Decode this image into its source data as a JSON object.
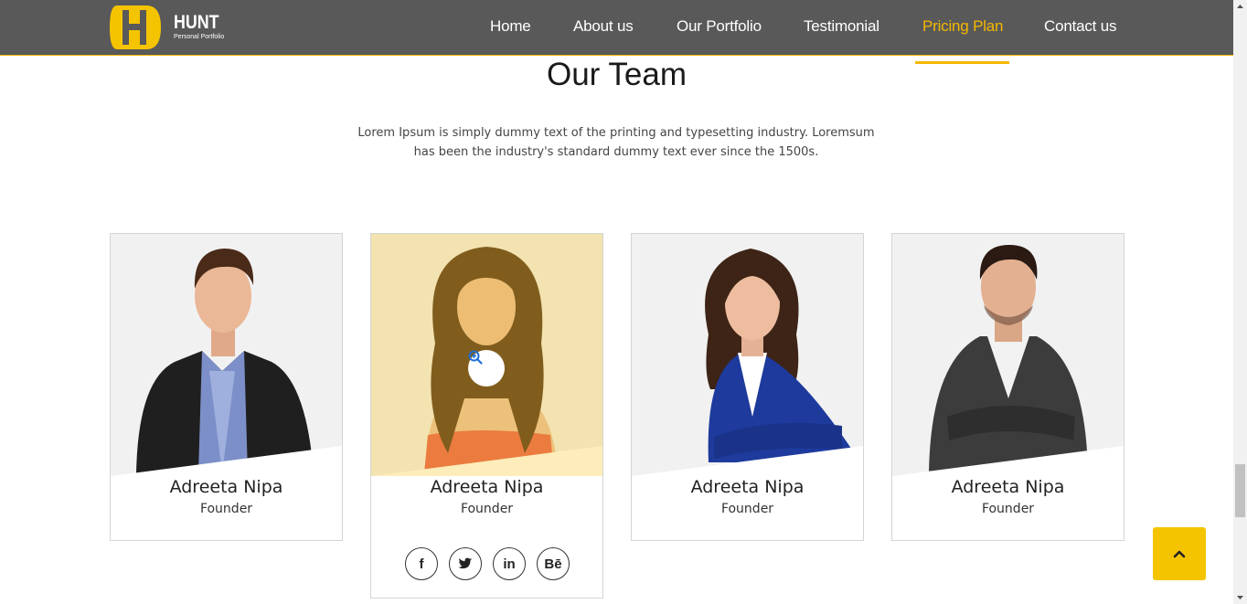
{
  "brand": {
    "name": "HUNT",
    "tagline": "Personal Portfolio",
    "logo_letter": "H",
    "accent_color": "#f5b800"
  },
  "nav": {
    "items": [
      {
        "label": "Home",
        "active": false
      },
      {
        "label": "About us",
        "active": false
      },
      {
        "label": "Our Portfolio",
        "active": false
      },
      {
        "label": "Testimonial",
        "active": false
      },
      {
        "label": "Pricing Plan",
        "active": true
      },
      {
        "label": "Contact us",
        "active": false
      }
    ]
  },
  "section": {
    "title": "Our Team",
    "description": "Lorem Ipsum is simply dummy text of the printing and typesetting industry. Loremsum has been the industry's standard dummy text ever since the 1500s."
  },
  "team": [
    {
      "name": "Adreeta Nipa",
      "role": "Founder",
      "photo_icon": "man-portrait-icon"
    },
    {
      "name": "Adreeta Nipa",
      "role": "Founder",
      "photo_icon": "woman-portrait-icon",
      "hovered": true
    },
    {
      "name": "Adreeta Nipa",
      "role": "Founder",
      "photo_icon": "woman-portrait-icon"
    },
    {
      "name": "Adreeta Nipa",
      "role": "Founder",
      "photo_icon": "man-portrait-icon"
    }
  ],
  "social": {
    "facebook": "f",
    "twitter": "twitter-bird",
    "linkedin": "in",
    "behance": "Bē"
  },
  "icons": {
    "zoom": "zoom-in-icon",
    "back_to_top": "chevron-up-icon"
  }
}
